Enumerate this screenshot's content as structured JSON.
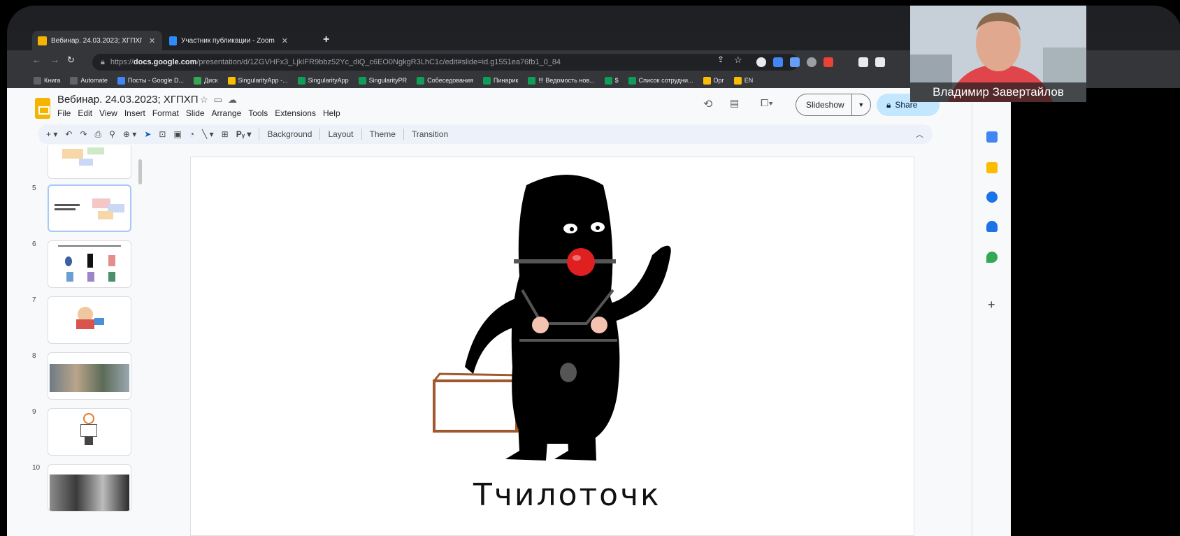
{
  "browser": {
    "tabs": [
      {
        "title": "Вебинар. 24.03.2023; ХГПХП",
        "favicon_color": "#f4b400"
      },
      {
        "title": "Участник публикации - Zoom",
        "favicon_color": "#2d8cff"
      }
    ],
    "new_tab_label": "+",
    "url_prefix": "https://",
    "url_host": "docs.google.com",
    "url_path": "/presentation/d/1ZGVHFx3_LjkIFR9bbz52Yc_diQ_c6EO0NgkgR3LhC1c/edit#slide=id.g1551ea76fb1_0_84",
    "bookmarks": [
      {
        "label": "Книга",
        "color": "#5f6368"
      },
      {
        "label": "Automate",
        "color": "#5f6368"
      },
      {
        "label": "Посты - Google D...",
        "color": "#4285f4"
      },
      {
        "label": "Диск",
        "color": "#34a853"
      },
      {
        "label": "SingularityApp -...",
        "color": "#fbbc04"
      },
      {
        "label": "SingularityApp",
        "color": "#0f9d58"
      },
      {
        "label": "SingularityPR",
        "color": "#0f9d58"
      },
      {
        "label": "Собеседования",
        "color": "#0f9d58"
      },
      {
        "label": "Пинарик",
        "color": "#0f9d58"
      },
      {
        "label": "!!! Ведомость нов...",
        "color": "#0f9d58"
      },
      {
        "label": "$",
        "color": "#0f9d58"
      },
      {
        "label": "Список сотрудни...",
        "color": "#0f9d58"
      },
      {
        "label": "Орг",
        "color": "#fbbc04"
      },
      {
        "label": "EN",
        "color": "#fbbc04"
      }
    ]
  },
  "docs": {
    "title": "Вебинар. 24.03.2023; ХГПХП",
    "menu": [
      "File",
      "Edit",
      "View",
      "Insert",
      "Format",
      "Slide",
      "Arrange",
      "Tools",
      "Extensions",
      "Help"
    ],
    "slideshow_label": "Slideshow",
    "share_label": "Share",
    "toolbar_text_buttons": [
      "Background",
      "Layout",
      "Theme",
      "Transition"
    ],
    "accent_color": "#c2e7ff"
  },
  "filmstrip": {
    "slides": [
      {
        "number": "",
        "caption": ""
      },
      {
        "number": "5",
        "caption": ""
      },
      {
        "number": "6",
        "caption": ""
      },
      {
        "number": "7",
        "caption": ""
      },
      {
        "number": "8",
        "caption": ""
      },
      {
        "number": "9",
        "caption": ""
      },
      {
        "number": "10",
        "caption": ""
      }
    ],
    "selected_index": 1
  },
  "slide": {
    "title_partial": "Тчилоточк"
  },
  "video": {
    "participant_name": "Владимир Завертайлов"
  }
}
